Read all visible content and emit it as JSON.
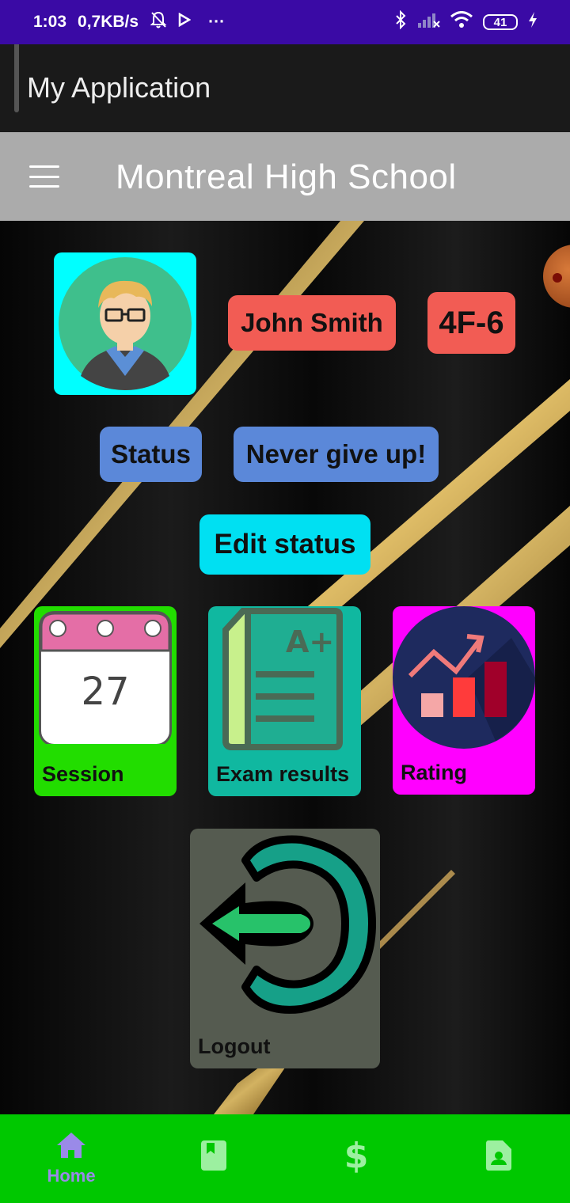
{
  "status_bar": {
    "time": "1:03",
    "speed": "0,7KB/s",
    "more": "···",
    "battery": "41"
  },
  "app": {
    "title": "My Application"
  },
  "header": {
    "school_name": "Montreal High School",
    "menu_icon": "hamburger-menu-icon"
  },
  "profile": {
    "name": "John Smith",
    "class": "4F-6",
    "status_label": "Status",
    "status_text": "Never give up!",
    "edit_status_label": "Edit status"
  },
  "tiles": {
    "session": {
      "label": "Session",
      "calendar_day": "27",
      "color": "#22dd00"
    },
    "exam": {
      "label": "Exam results",
      "grade": "A+",
      "color": "#10b8a0"
    },
    "rating": {
      "label": "Rating",
      "color": "#ff00ff"
    },
    "logout": {
      "label": "Logout",
      "color": "#555b50"
    }
  },
  "bottom_nav": {
    "items": [
      {
        "label": "Home",
        "icon": "home-icon",
        "active": true
      },
      {
        "label": "",
        "icon": "book-icon"
      },
      {
        "label": "",
        "icon": "dollar-icon",
        "glyph": "$"
      },
      {
        "label": "",
        "icon": "contact-icon"
      }
    ]
  },
  "colors": {
    "status_bar": "#3a0aa5",
    "nav_bar": "#00c800",
    "chip_red": "#f25c54",
    "chip_blue": "#5b88d9",
    "edit_button": "#00e0f2",
    "avatar_bg": "#00ffff"
  }
}
